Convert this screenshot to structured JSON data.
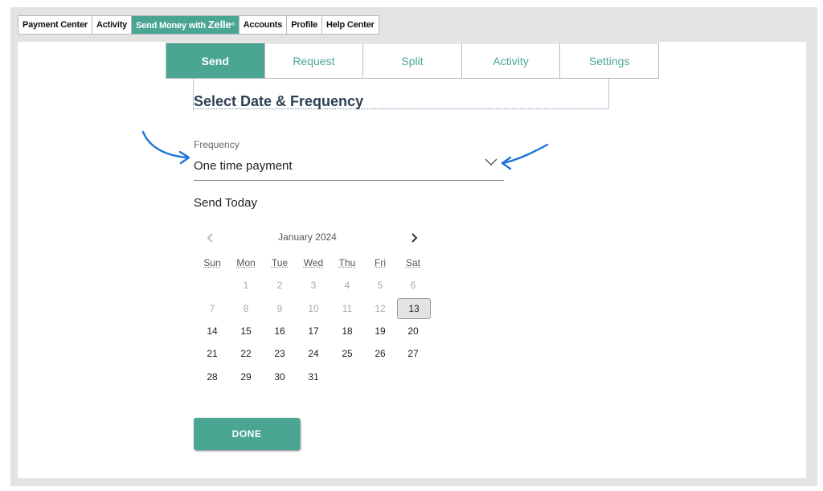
{
  "top_nav": {
    "items": [
      {
        "label": "Payment Center"
      },
      {
        "label": "Activity"
      },
      {
        "label_prefix": "Send Money with ",
        "label_brand": "Zelle",
        "label_mark": "®"
      },
      {
        "label": "Accounts"
      },
      {
        "label": "Profile"
      },
      {
        "label": "Help Center"
      }
    ]
  },
  "tabs": [
    {
      "label": "Send",
      "active": true
    },
    {
      "label": "Request"
    },
    {
      "label": "Split"
    },
    {
      "label": "Activity"
    },
    {
      "label": "Settings"
    }
  ],
  "section_title": "Select Date & Frequency",
  "frequency": {
    "label": "Frequency",
    "value": "One time payment"
  },
  "send_today": "Send Today",
  "calendar": {
    "month": "January 2024",
    "weekdays": [
      "Sun",
      "Mon",
      "Tue",
      "Wed",
      "Thu",
      "Fri",
      "Sat"
    ],
    "rows": [
      [
        "",
        "1",
        "2",
        "3",
        "4",
        "5",
        "6"
      ],
      [
        "7",
        "8",
        "9",
        "10",
        "11",
        "12",
        "13"
      ],
      [
        "14",
        "15",
        "16",
        "17",
        "18",
        "19",
        "20"
      ],
      [
        "21",
        "22",
        "23",
        "24",
        "25",
        "26",
        "27"
      ],
      [
        "28",
        "29",
        "30",
        "31",
        "",
        "",
        ""
      ]
    ],
    "selected": "13"
  },
  "done_label": "DONE",
  "colors": {
    "accent": "#4aa693",
    "annotation": "#1d72d8"
  },
  "icons": {
    "prev": "chevron-left-icon",
    "next": "chevron-right-icon",
    "dropdown": "chevron-down-icon"
  }
}
